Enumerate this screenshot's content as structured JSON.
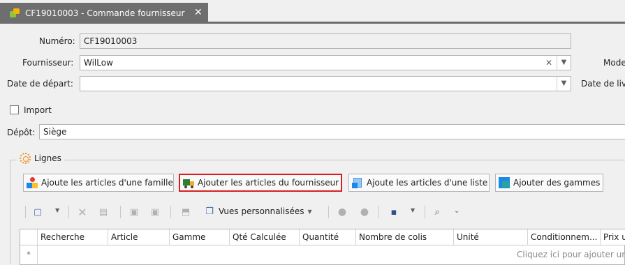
{
  "tab": {
    "title": "CF19010003 - Commande fournisseur",
    "close": "✕"
  },
  "form": {
    "numero_label": "Numéro:",
    "numero_value": "CF19010003",
    "fournisseur_label": "Fournisseur:",
    "fournisseur_value": "WilLow",
    "date_depart_label": "Date de départ:",
    "date_depart_value": "",
    "mode_label": "Mode",
    "date_livraison_label": "Date de liv",
    "import_label": "Import",
    "import_checked": false,
    "depot_label": "Dépôt:",
    "depot_value": "Siège"
  },
  "group": {
    "title": "Lignes"
  },
  "actions": [
    {
      "label": "Ajoute les articles d'une famille"
    },
    {
      "label": "Ajouter les articles du fournisseur"
    },
    {
      "label": "Ajoute les articles d'une liste"
    },
    {
      "label": "Ajouter des gammes"
    }
  ],
  "toolbar": {
    "vues_label": "Vues personnalisées"
  },
  "grid": {
    "columns": [
      "Recherche",
      "Article",
      "Gamme",
      "Qté Calculée",
      "Quantité",
      "Nombre de colis",
      "Unité",
      "Conditionnem...",
      "Prix u"
    ],
    "new_row_marker": "*",
    "new_row_hint": "Cliquez ici pour ajouter une no"
  },
  "colors": {
    "tab_bg": "#6e6e6e",
    "highlight": "#d81e1e",
    "accent": "#4d6fb0"
  }
}
